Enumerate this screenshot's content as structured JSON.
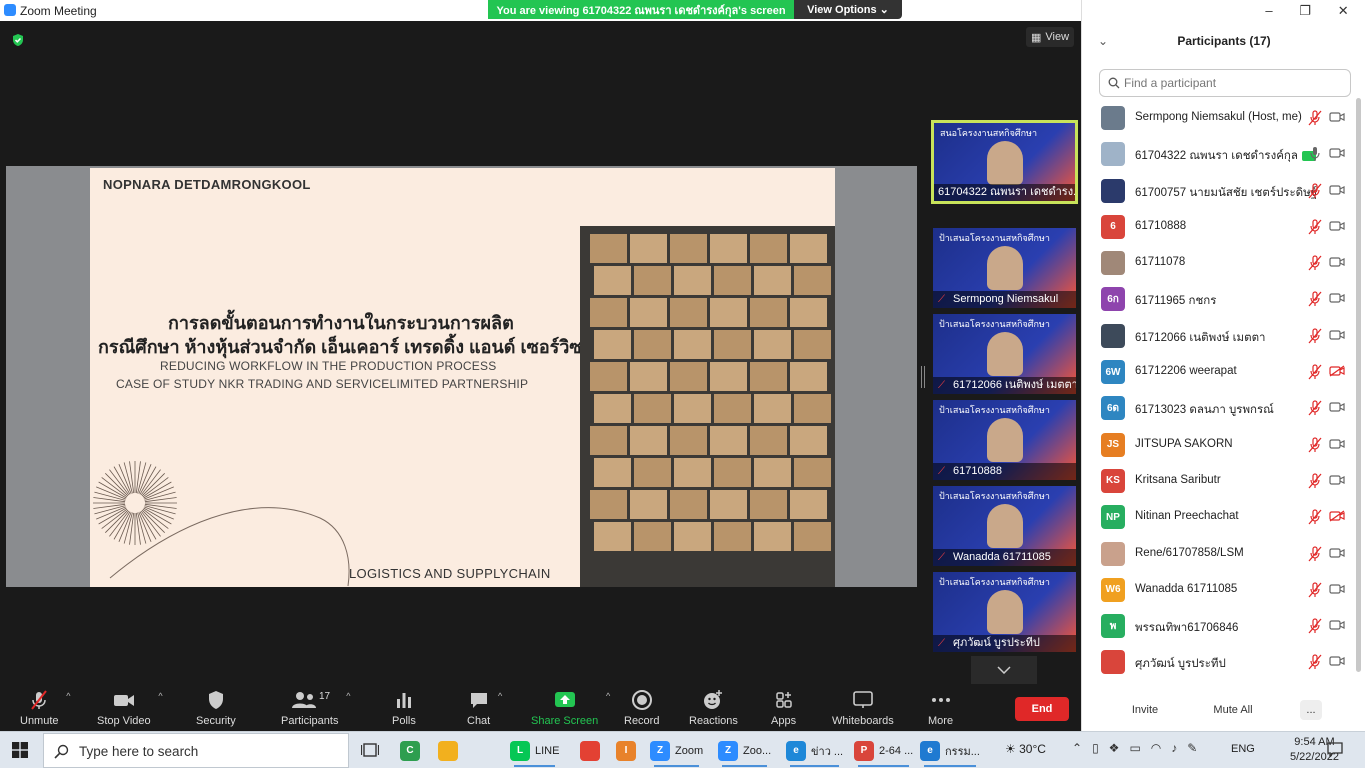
{
  "window": {
    "title": "Zoom Meeting",
    "viewing_banner": "You are viewing 61704322 ณพนรา เดชดำรงค์กุล's screen",
    "view_options": "View Options",
    "view_button": "View"
  },
  "slide": {
    "author": "NOPNARA DETDAMRONGKOOL",
    "title_th_1": "การลดขั้นตอนการทำงานในกระบวนการผลิต",
    "title_th_2": "กรณีศึกษา ห้างหุ้นส่วนจำกัด เอ็นเคอาร์ เทรดดิ้ง แอนด์ เซอร์วิซ",
    "title_en_1": "REDUCING WORKFLOW IN THE PRODUCTION PROCESS",
    "title_en_2": "CASE OF STUDY NKR TRADING AND SERVICELIMITED PARTNERSHIP",
    "footer": "LOGISTICS AND SUPPLYCHAIN"
  },
  "video_tiles": [
    {
      "name": "61704322 ณพนรา เดชดำรง...",
      "banner": "สนอโครงงานสหกิจศึกษา",
      "active": true
    },
    {
      "name": "Sermpong Niemsakul",
      "banner": "ป้าเสนอโครงงานสหกิจศึกษา",
      "active": false
    },
    {
      "name": "61712066 เนติพงษ์ เมตตา",
      "banner": "ป้าเสนอโครงงานสหกิจศึกษา",
      "active": false
    },
    {
      "name": "61710888",
      "banner": "ป้าเสนอโครงงานสหกิจศึกษา",
      "active": false
    },
    {
      "name": "Wanadda 61711085",
      "banner": "ป้าเสนอโครงงานสหกิจศึกษา",
      "active": false
    },
    {
      "name": "ศุภวัฒน์ บูรประทีป",
      "banner": "ป้าเสนอโครงงานสหกิจศึกษา",
      "active": false
    }
  ],
  "toolbar": {
    "unmute": "Unmute",
    "stop_video": "Stop Video",
    "security": "Security",
    "participants": "Participants",
    "participants_count": "17",
    "polls": "Polls",
    "chat": "Chat",
    "share_screen": "Share Screen",
    "record": "Record",
    "reactions": "Reactions",
    "apps": "Apps",
    "whiteboards": "Whiteboards",
    "more": "More",
    "end": "End"
  },
  "panel": {
    "title": "Participants (17)",
    "search_placeholder": "Find a participant",
    "invite": "Invite",
    "mute_all": "Mute All",
    "more": "..."
  },
  "participants": [
    {
      "name": "Sermpong Niemsakul (Host, me)",
      "initials": "",
      "color": "#6b7b8c",
      "mic_muted": true,
      "cam_off": false
    },
    {
      "name": "61704322 ณพนรา เดชดำรงค์กุล",
      "initials": "",
      "color": "#9fb3c8",
      "mic_muted": false,
      "cam_off": false,
      "sharing": true
    },
    {
      "name": "61700757 นายมนัสชัย เชตร์ประดิษฐ์",
      "initials": "",
      "color": "#2b3a6b",
      "mic_muted": true,
      "cam_off": false
    },
    {
      "name": "61710888",
      "initials": "6",
      "color": "#d9453b",
      "mic_muted": true,
      "cam_off": false
    },
    {
      "name": "61711078",
      "initials": "",
      "color": "#a08878",
      "mic_muted": true,
      "cam_off": false
    },
    {
      "name": "61711965 กชกร",
      "initials": "6ก",
      "color": "#8e44ad",
      "mic_muted": true,
      "cam_off": false
    },
    {
      "name": "61712066 เนติพงษ์ เมตตา",
      "initials": "",
      "color": "#3d4a5a",
      "mic_muted": true,
      "cam_off": false
    },
    {
      "name": "61712206 weerapat",
      "initials": "6W",
      "color": "#2e86c1",
      "mic_muted": true,
      "cam_off": true
    },
    {
      "name": "61713023 ดลนภา บูรพกรณ์",
      "initials": "6ด",
      "color": "#2e86c1",
      "mic_muted": true,
      "cam_off": false
    },
    {
      "name": "JITSUPA  SAKORN",
      "initials": "JS",
      "color": "#e67e22",
      "mic_muted": true,
      "cam_off": false
    },
    {
      "name": "Kritsana Saributr",
      "initials": "KS",
      "color": "#d9453b",
      "mic_muted": true,
      "cam_off": false
    },
    {
      "name": "Nitinan Preechachat",
      "initials": "NP",
      "color": "#27ae60",
      "mic_muted": true,
      "cam_off": true
    },
    {
      "name": "Rene/61707858/LSM",
      "initials": "",
      "color": "#c9a18c",
      "mic_muted": true,
      "cam_off": false
    },
    {
      "name": "Wanadda 61711085",
      "initials": "W6",
      "color": "#f0a020",
      "mic_muted": true,
      "cam_off": false
    },
    {
      "name": "พรรณทิพา61706846",
      "initials": "พ",
      "color": "#27ae60",
      "mic_muted": true,
      "cam_off": false
    },
    {
      "name": "ศุภวัฒน์ บูรประทีป",
      "initials": "",
      "color": "#d9453b",
      "mic_muted": true,
      "cam_off": false
    }
  ],
  "taskbar": {
    "search_label": "Type here to search",
    "apps": [
      {
        "label": "",
        "icon": "C",
        "color": "#2e9e4f"
      },
      {
        "label": "",
        "icon": "",
        "color": "#f2b01e"
      },
      {
        "label": "LINE",
        "icon": "L",
        "color": "#06c755"
      },
      {
        "label": "",
        "icon": "",
        "color": "#e34133"
      },
      {
        "label": "",
        "icon": "I",
        "color": "#e8822a"
      },
      {
        "label": "Zoom",
        "icon": "Z",
        "color": "#2d8cff"
      },
      {
        "label": "Zoo...",
        "icon": "Z",
        "color": "#2d8cff"
      },
      {
        "label": "ข่าว ...",
        "icon": "e",
        "color": "#1e88d8"
      },
      {
        "label": "2-64 ...",
        "icon": "P",
        "color": "#d9453b"
      },
      {
        "label": "กรรม...",
        "icon": "e",
        "color": "#1f7ad1"
      }
    ],
    "temperature": "30°C",
    "language": "ENG",
    "time": "9:54 AM",
    "date": "5/22/2022"
  },
  "colors": {
    "accent_green": "#23c552",
    "end_red": "#e02828",
    "active_border": "#c8e35a"
  }
}
